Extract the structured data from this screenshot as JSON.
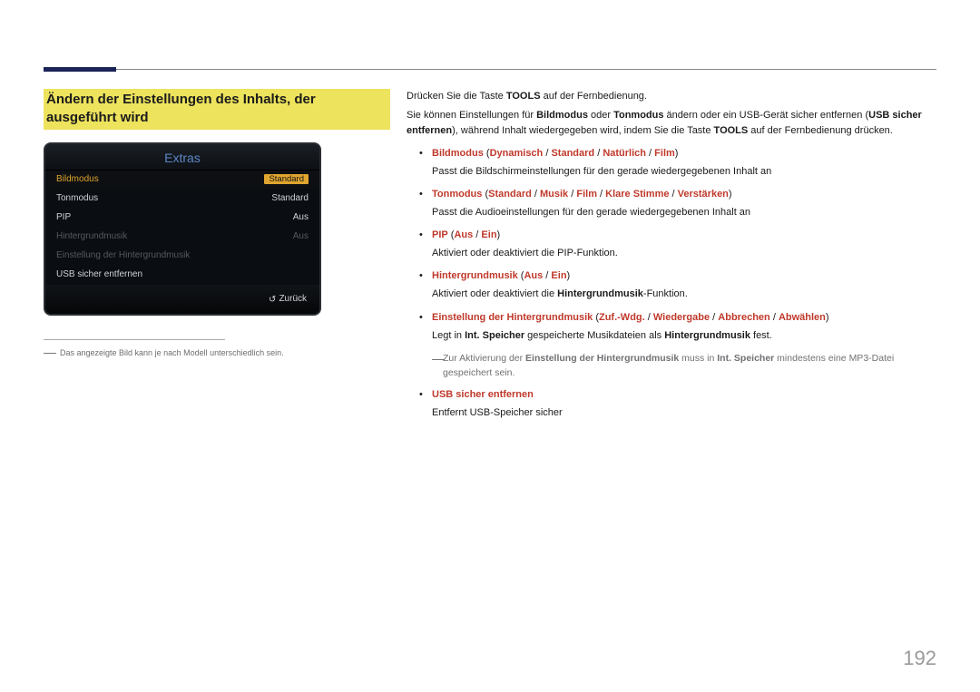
{
  "header_accent_color": "#1a2456",
  "section_title": "Ändern der Einstellungen des Inhalts, der ausgeführt wird",
  "device_panel": {
    "title": "Extras",
    "rows": [
      {
        "label": "Bildmodus",
        "value": "Standard",
        "state": "selected"
      },
      {
        "label": "Tonmodus",
        "value": "Standard",
        "state": "normal"
      },
      {
        "label": "PIP",
        "value": "Aus",
        "state": "normal"
      },
      {
        "label": "Hintergrundmusik",
        "value": "Aus",
        "state": "dim"
      },
      {
        "label": "Einstellung der Hintergrundmusik",
        "value": "",
        "state": "dim"
      },
      {
        "label": "USB sicher entfernen",
        "value": "",
        "state": "normal"
      }
    ],
    "footer": "Zurück"
  },
  "footnote": "Das angezeigte Bild kann je nach Modell unterschiedlich sein.",
  "intro1_pre": "Drücken Sie die Taste ",
  "intro1_b": "TOOLS",
  "intro1_post": " auf der Fernbedienung.",
  "intro2_a": "Sie können Einstellungen für ",
  "intro2_b1": "Bildmodus",
  "intro2_mid": " oder ",
  "intro2_b2": "Tonmodus",
  "intro2_c": " ändern oder ein USB-Gerät sicher entfernen (",
  "intro2_b3": "USB sicher entfernen",
  "intro2_d": "), während Inhalt wiedergegeben wird, indem Sie die Taste ",
  "intro2_b4": "TOOLS",
  "intro2_e": " auf der Fernbedienung drücken.",
  "b1_name": "Bildmodus",
  "b1_o1": "Dynamisch",
  "b1_o2": "Standard",
  "b1_o3": "Natürlich",
  "b1_o4": "Film",
  "b1_desc": "Passt die Bildschirmeinstellungen für den gerade wiedergegebenen Inhalt an",
  "b2_name": "Tonmodus",
  "b2_o1": "Standard",
  "b2_o2": "Musik",
  "b2_o3": "Film",
  "b2_o4": "Klare Stimme",
  "b2_o5": "Verstärken",
  "b2_desc": "Passt die Audioeinstellungen für den gerade wiedergegebenen Inhalt an",
  "b3_name": "PIP",
  "b3_o1": "Aus",
  "b3_o2": "Ein",
  "b3_desc": "Aktiviert oder deaktiviert die PIP-Funktion.",
  "b4_name": "Hintergrundmusik",
  "b4_o1": "Aus",
  "b4_o2": "Ein",
  "b4_desc_a": "Aktiviert oder deaktiviert die ",
  "b4_desc_b": "Hintergrundmusik",
  "b4_desc_c": "-Funktion.",
  "b5_name": "Einstellung der Hintergrundmusik",
  "b5_o1": "Zuf.-Wdg.",
  "b5_o2": "Wiedergabe",
  "b5_o3": "Abbrechen",
  "b5_o4": "Abwählen",
  "b5_desc_a": "Legt in ",
  "b5_desc_b": "Int. Speicher",
  "b5_desc_c": " gespeicherte Musikdateien als ",
  "b5_desc_d": "Hintergrundmusik",
  "b5_desc_e": " fest.",
  "note_a": "Zur Aktivierung der ",
  "note_b1": "Einstellung der Hintergrundmusik",
  "note_mid": " muss in ",
  "note_b2": "Int. Speicher",
  "note_c": " mindestens eine MP3-Datei gespeichert sein.",
  "b6_name": "USB sicher entfernen",
  "b6_desc": "Entfernt USB-Speicher sicher",
  "page_number": "192"
}
